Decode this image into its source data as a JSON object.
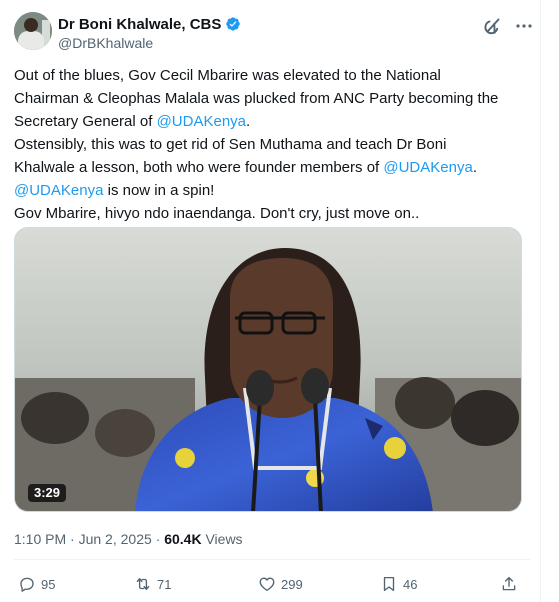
{
  "author": {
    "display_name": "Dr Boni Khalwale, CBS",
    "handle": "@DrBKhalwale",
    "verified": true
  },
  "tweet": {
    "lines": [
      [
        {
          "text": "Out of the blues, Gov Cecil Mbarire was elevated to the National",
          "mention": false
        }
      ],
      [
        {
          "text": "Chairman & Cleophas Malala was plucked from ANC Party becoming the",
          "mention": false
        }
      ],
      [
        {
          "text": "Secretary General of ",
          "mention": false
        },
        {
          "text": "@UDAKenya",
          "mention": true
        },
        {
          "text": ".",
          "mention": false
        }
      ],
      [
        {
          "text": "Ostensibly, this was to get rid of Sen Muthama and teach Dr Boni",
          "mention": false
        }
      ],
      [
        {
          "text": "Khalwale a lesson, both who were founder members of ",
          "mention": false
        },
        {
          "text": "@UDAKenya",
          "mention": true
        },
        {
          "text": ".",
          "mention": false
        }
      ],
      [
        {
          "text": "@UDAKenya",
          "mention": true
        },
        {
          "text": " is now in a spin!",
          "mention": false
        }
      ],
      [
        {
          "text": "Gov Mbarire, hivyo ndo inaendanga. Don't cry, just move on..",
          "mention": false
        }
      ]
    ]
  },
  "media": {
    "type": "video",
    "duration": "3:29"
  },
  "meta": {
    "time": "1:10 PM",
    "separator": " · ",
    "date": "Jun 2, 2025",
    "views_count": "60.4K",
    "views_label": " Views"
  },
  "actions": {
    "replies": "95",
    "reposts": "71",
    "likes": "299",
    "bookmarks": "46"
  },
  "colors": {
    "text": "#0f1419",
    "secondary": "#536471",
    "link": "#1d9bf0",
    "verified_badge": "#1d9bf0",
    "divider": "#eff3f4"
  },
  "icons": [
    "verified-badge-icon",
    "grok-icon",
    "more-icon",
    "reply-icon",
    "repost-icon",
    "like-icon",
    "bookmark-icon",
    "share-icon"
  ]
}
